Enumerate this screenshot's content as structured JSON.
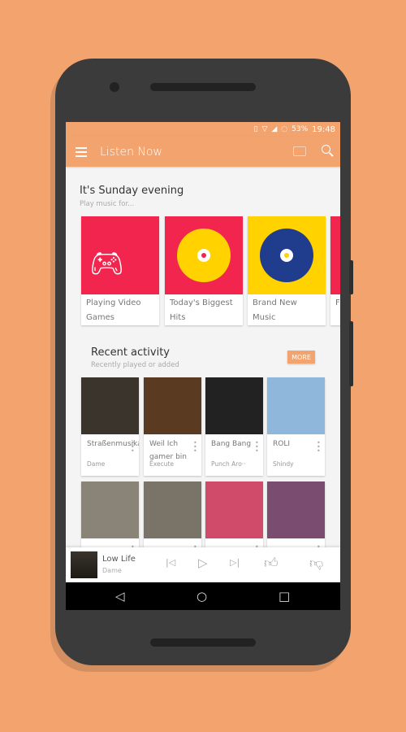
{
  "status": {
    "battery": "53%",
    "time": "19:48"
  },
  "appbar": {
    "title": "Listen Now"
  },
  "section1": {
    "title": "It's Sunday evening",
    "subtitle": "Play music for...",
    "cards": [
      {
        "label": "Playing Video Games",
        "color": "#F2254F"
      },
      {
        "label": "Today's Biggest Hits",
        "color": "#F2254F"
      },
      {
        "label": "Brand New Music",
        "color": "#FFD200"
      },
      {
        "label": "F",
        "color": "#F2254F"
      }
    ]
  },
  "section2": {
    "title": "Recent activity",
    "subtitle": "Recently played or added",
    "more": "MORE",
    "items": [
      {
        "title": "Straßenmusikant",
        "artist": "Dame",
        "art": "#3a342c"
      },
      {
        "title": "Weil Ich gamer bin",
        "artist": "Execute",
        "art": "#5a3a20"
      },
      {
        "title": "Bang Bang",
        "artist": "Punch Aro··",
        "art": "#222"
      },
      {
        "title": "ROLI",
        "artist": "Shindy",
        "art": "#8fb7dc"
      },
      {
        "title": "",
        "artist": "",
        "art": "#8a8478"
      },
      {
        "title": "",
        "artist": "",
        "art": "#7a7468"
      },
      {
        "title": "",
        "artist": "",
        "art": "#d04a6a"
      },
      {
        "title": "",
        "artist": "",
        "art": "#7a4d70"
      }
    ]
  },
  "player": {
    "title": "Low Life",
    "artist": "Dame"
  }
}
